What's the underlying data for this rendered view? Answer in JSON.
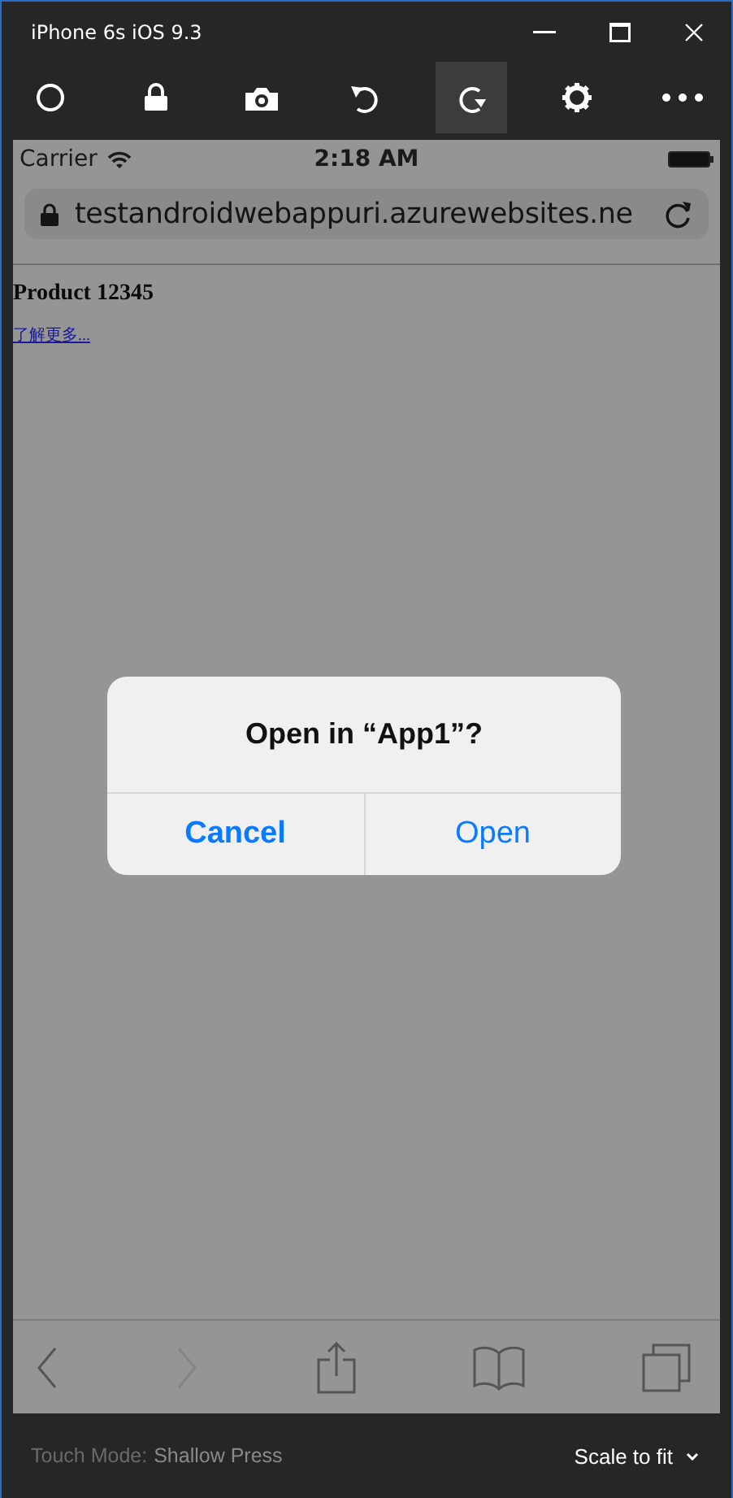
{
  "window": {
    "title": "iPhone 6s iOS 9.3"
  },
  "toolbar": [
    {
      "kind": "home",
      "selected": false
    },
    {
      "kind": "lock",
      "selected": false
    },
    {
      "kind": "camera",
      "selected": false
    },
    {
      "kind": "rotate-left",
      "selected": false
    },
    {
      "kind": "rotate-right",
      "selected": true
    },
    {
      "kind": "settings",
      "selected": false
    },
    {
      "kind": "more",
      "selected": false
    }
  ],
  "status_bar": {
    "carrier": "Carrier",
    "time": "2:18 AM"
  },
  "address_bar": {
    "url": "testandroidwebappuri.azurewebsites.ne"
  },
  "page": {
    "heading": "Product 12345",
    "link": "了解更多..."
  },
  "dialog": {
    "title": "Open in “App1”?",
    "buttons": [
      {
        "label": "Cancel",
        "kind": "cancel"
      },
      {
        "label": "Open",
        "kind": "default"
      }
    ]
  },
  "browser_toolbar": [
    {
      "kind": "back",
      "disabled": false
    },
    {
      "kind": "forward",
      "disabled": true
    },
    {
      "kind": "share",
      "disabled": false
    },
    {
      "kind": "bookmarks",
      "disabled": false
    },
    {
      "kind": "tabs",
      "disabled": false
    }
  ],
  "footer": {
    "touch_mode_label": "Touch Mode:",
    "touch_mode_value": "Shallow Press",
    "scale": "Scale to fit"
  }
}
